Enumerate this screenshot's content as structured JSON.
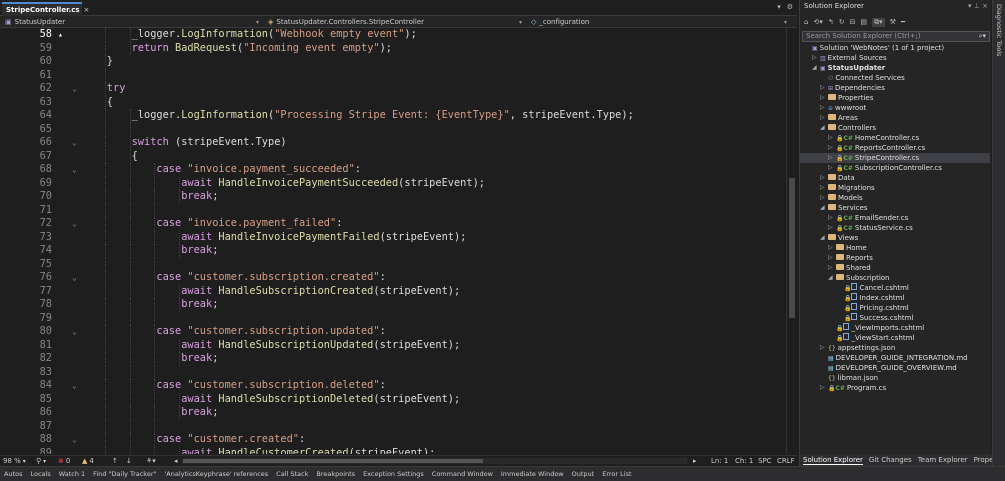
{
  "editor": {
    "tab": {
      "title": "StripeController.cs",
      "pin": "⊞",
      "close": "×"
    },
    "nav": {
      "project": "StatusUpdater",
      "class": "StatusUpdater.Controllers.StripeController",
      "member": "_configuration"
    },
    "lines": [
      {
        "n": "58",
        "cur": true,
        "fold": false,
        "indent": 3,
        "toks": [
          {
            "t": "_logger.",
            "c": "def"
          },
          {
            "t": "LogInformation",
            "c": "yel"
          },
          {
            "t": "(",
            "c": "def"
          },
          {
            "t": "\"Webhook empty event\"",
            "c": "str"
          },
          {
            "t": ");",
            "c": "def"
          }
        ]
      },
      {
        "n": "59",
        "fold": false,
        "indent": 3,
        "toks": [
          {
            "t": "return ",
            "c": "ctl"
          },
          {
            "t": "BadRequest",
            "c": "yel"
          },
          {
            "t": "(",
            "c": "def"
          },
          {
            "t": "\"Incoming event empty\"",
            "c": "str"
          },
          {
            "t": ");",
            "c": "def"
          }
        ]
      },
      {
        "n": "60",
        "fold": false,
        "indent": 2,
        "toks": [
          {
            "t": "}",
            "c": "def"
          }
        ]
      },
      {
        "n": "61",
        "fold": false,
        "indent": 2,
        "toks": []
      },
      {
        "n": "62",
        "fold": true,
        "indent": 2,
        "toks": [
          {
            "t": "try",
            "c": "ctl"
          }
        ]
      },
      {
        "n": "63",
        "fold": false,
        "indent": 2,
        "toks": [
          {
            "t": "{",
            "c": "def"
          }
        ]
      },
      {
        "n": "64",
        "fold": false,
        "indent": 3,
        "toks": [
          {
            "t": "_logger.",
            "c": "def"
          },
          {
            "t": "LogInformation",
            "c": "yel"
          },
          {
            "t": "(",
            "c": "def"
          },
          {
            "t": "\"Processing Stripe Event: {EventType}\"",
            "c": "str"
          },
          {
            "t": ", stripeEvent.",
            "c": "def"
          },
          {
            "t": "Type",
            "c": "def"
          },
          {
            "t": ");",
            "c": "def"
          }
        ]
      },
      {
        "n": "65",
        "fold": false,
        "indent": 3,
        "toks": []
      },
      {
        "n": "66",
        "fold": true,
        "indent": 3,
        "toks": [
          {
            "t": "switch ",
            "c": "ctl"
          },
          {
            "t": "(stripeEvent.Type)",
            "c": "def"
          }
        ]
      },
      {
        "n": "67",
        "fold": false,
        "indent": 3,
        "toks": [
          {
            "t": "{",
            "c": "def"
          }
        ]
      },
      {
        "n": "68",
        "fold": true,
        "indent": 4,
        "toks": [
          {
            "t": "case ",
            "c": "ctl"
          },
          {
            "t": "\"invoice.payment_succeeded\"",
            "c": "str"
          },
          {
            "t": ":",
            "c": "def"
          }
        ]
      },
      {
        "n": "69",
        "fold": false,
        "indent": 5,
        "toks": [
          {
            "t": "await ",
            "c": "ctl"
          },
          {
            "t": "HandleInvoicePaymentSucceeded",
            "c": "yel"
          },
          {
            "t": "(stripeEvent);",
            "c": "def"
          }
        ]
      },
      {
        "n": "70",
        "fold": false,
        "indent": 5,
        "toks": [
          {
            "t": "break",
            "c": "ctl"
          },
          {
            "t": ";",
            "c": "def"
          }
        ]
      },
      {
        "n": "71",
        "fold": false,
        "indent": 4,
        "toks": []
      },
      {
        "n": "72",
        "fold": true,
        "indent": 4,
        "toks": [
          {
            "t": "case ",
            "c": "ctl"
          },
          {
            "t": "\"invoice.payment_failed\"",
            "c": "str"
          },
          {
            "t": ":",
            "c": "def"
          }
        ]
      },
      {
        "n": "73",
        "fold": false,
        "indent": 5,
        "toks": [
          {
            "t": "await ",
            "c": "ctl"
          },
          {
            "t": "HandleInvoicePaymentFailed",
            "c": "yel"
          },
          {
            "t": "(stripeEvent);",
            "c": "def"
          }
        ]
      },
      {
        "n": "74",
        "fold": false,
        "indent": 5,
        "toks": [
          {
            "t": "break",
            "c": "ctl"
          },
          {
            "t": ";",
            "c": "def"
          }
        ]
      },
      {
        "n": "75",
        "fold": false,
        "indent": 4,
        "toks": []
      },
      {
        "n": "76",
        "fold": true,
        "indent": 4,
        "toks": [
          {
            "t": "case ",
            "c": "ctl"
          },
          {
            "t": "\"customer.subscription.created\"",
            "c": "str"
          },
          {
            "t": ":",
            "c": "def"
          }
        ]
      },
      {
        "n": "77",
        "fold": false,
        "indent": 5,
        "toks": [
          {
            "t": "await ",
            "c": "ctl"
          },
          {
            "t": "HandleSubscriptionCreated",
            "c": "yel"
          },
          {
            "t": "(stripeEvent);",
            "c": "def"
          }
        ]
      },
      {
        "n": "78",
        "fold": false,
        "indent": 5,
        "toks": [
          {
            "t": "break",
            "c": "ctl"
          },
          {
            "t": ";",
            "c": "def"
          }
        ]
      },
      {
        "n": "79",
        "fold": false,
        "indent": 4,
        "toks": []
      },
      {
        "n": "80",
        "fold": true,
        "indent": 4,
        "toks": [
          {
            "t": "case ",
            "c": "ctl"
          },
          {
            "t": "\"customer.subscription.updated\"",
            "c": "str"
          },
          {
            "t": ":",
            "c": "def"
          }
        ]
      },
      {
        "n": "81",
        "fold": false,
        "indent": 5,
        "toks": [
          {
            "t": "await ",
            "c": "ctl"
          },
          {
            "t": "HandleSubscriptionUpdated",
            "c": "yel"
          },
          {
            "t": "(stripeEvent);",
            "c": "def"
          }
        ]
      },
      {
        "n": "82",
        "fold": false,
        "indent": 5,
        "toks": [
          {
            "t": "break",
            "c": "ctl"
          },
          {
            "t": ";",
            "c": "def"
          }
        ]
      },
      {
        "n": "83",
        "fold": false,
        "indent": 4,
        "toks": []
      },
      {
        "n": "84",
        "fold": true,
        "indent": 4,
        "toks": [
          {
            "t": "case ",
            "c": "ctl"
          },
          {
            "t": "\"customer.subscription.deleted\"",
            "c": "str"
          },
          {
            "t": ":",
            "c": "def"
          }
        ]
      },
      {
        "n": "85",
        "fold": false,
        "indent": 5,
        "toks": [
          {
            "t": "await ",
            "c": "ctl"
          },
          {
            "t": "HandleSubscriptionDeleted",
            "c": "yel"
          },
          {
            "t": "(stripeEvent);",
            "c": "def"
          }
        ]
      },
      {
        "n": "86",
        "fold": false,
        "indent": 5,
        "toks": [
          {
            "t": "break",
            "c": "ctl"
          },
          {
            "t": ";",
            "c": "def"
          }
        ]
      },
      {
        "n": "87",
        "fold": false,
        "indent": 4,
        "toks": []
      },
      {
        "n": "88",
        "fold": true,
        "indent": 4,
        "toks": [
          {
            "t": "case ",
            "c": "ctl"
          },
          {
            "t": "\"customer.created\"",
            "c": "str"
          },
          {
            "t": ":",
            "c": "def"
          }
        ]
      },
      {
        "n": "89",
        "fold": false,
        "indent": 5,
        "toks": [
          {
            "t": "await ",
            "c": "ctl"
          },
          {
            "t": "HandleCustomerCreated",
            "c": "yel"
          },
          {
            "t": "(stripeEvent);",
            "c": "def"
          }
        ]
      }
    ],
    "status": {
      "zoom": "98 %",
      "errors": "0",
      "warnings": "4",
      "ln": "Ln: 1",
      "ch": "Ch: 1",
      "spc": "SPC",
      "crlf": "CRLF"
    }
  },
  "solution_explorer": {
    "title": "Solution Explorer",
    "search_placeholder": "Search Solution Explorer (Ctrl+;)",
    "items": [
      {
        "label": "Solution 'WebNotes' (1 of 1 project)",
        "depth": 0,
        "icon": "solution",
        "arrow": ""
      },
      {
        "label": "External Sources",
        "depth": 1,
        "icon": "ext",
        "arrow": "▷"
      },
      {
        "label": "StatusUpdater",
        "depth": 1,
        "icon": "project",
        "arrow": "◢",
        "bold": true
      },
      {
        "label": "Connected Services",
        "depth": 2,
        "icon": "services",
        "arrow": ""
      },
      {
        "label": "Dependencies",
        "depth": 2,
        "icon": "deps",
        "arrow": "▷"
      },
      {
        "label": "Properties",
        "depth": 2,
        "icon": "folder",
        "arrow": "▷"
      },
      {
        "label": "wwwroot",
        "depth": 2,
        "icon": "web",
        "arrow": "▷"
      },
      {
        "label": "Areas",
        "depth": 2,
        "icon": "folder",
        "arrow": "▷"
      },
      {
        "label": "Controllers",
        "depth": 2,
        "icon": "folder",
        "arrow": "◢"
      },
      {
        "label": "HomeController.cs",
        "depth": 3,
        "icon": "cs",
        "arrow": "▷"
      },
      {
        "label": "ReportsController.cs",
        "depth": 3,
        "icon": "cs",
        "arrow": "▷"
      },
      {
        "label": "StripeController.cs",
        "depth": 3,
        "icon": "cs",
        "arrow": "▷",
        "selected": true
      },
      {
        "label": "SubscriptionController.cs",
        "depth": 3,
        "icon": "cs",
        "arrow": "▷"
      },
      {
        "label": "Data",
        "depth": 2,
        "icon": "folder",
        "arrow": "▷"
      },
      {
        "label": "Migrations",
        "depth": 2,
        "icon": "folder",
        "arrow": "▷"
      },
      {
        "label": "Models",
        "depth": 2,
        "icon": "folder",
        "arrow": "▷"
      },
      {
        "label": "Services",
        "depth": 2,
        "icon": "folder",
        "arrow": "◢"
      },
      {
        "label": "EmailSender.cs",
        "depth": 3,
        "icon": "cs",
        "arrow": "▷"
      },
      {
        "label": "StatusService.cs",
        "depth": 3,
        "icon": "cs",
        "arrow": "▷"
      },
      {
        "label": "Views",
        "depth": 2,
        "icon": "folder",
        "arrow": "◢"
      },
      {
        "label": "Home",
        "depth": 3,
        "icon": "folder",
        "arrow": "▷"
      },
      {
        "label": "Reports",
        "depth": 3,
        "icon": "folder",
        "arrow": "▷"
      },
      {
        "label": "Shared",
        "depth": 3,
        "icon": "folder",
        "arrow": "▷"
      },
      {
        "label": "Subscription",
        "depth": 3,
        "icon": "folder",
        "arrow": "◢"
      },
      {
        "label": "Cancel.cshtml",
        "depth": 4,
        "icon": "cshtml",
        "arrow": ""
      },
      {
        "label": "Index.cshtml",
        "depth": 4,
        "icon": "cshtml",
        "arrow": ""
      },
      {
        "label": "Pricing.cshtml",
        "depth": 4,
        "icon": "cshtml",
        "arrow": ""
      },
      {
        "label": "Success.cshtml",
        "depth": 4,
        "icon": "cshtml",
        "arrow": ""
      },
      {
        "label": "_ViewImports.cshtml",
        "depth": 3,
        "icon": "cshtml",
        "arrow": ""
      },
      {
        "label": "_ViewStart.cshtml",
        "depth": 3,
        "icon": "cshtml",
        "arrow": ""
      },
      {
        "label": "appsettings.json",
        "depth": 2,
        "icon": "json",
        "arrow": "▷"
      },
      {
        "label": "DEVELOPER_GUIDE_INTEGRATION.md",
        "depth": 2,
        "icon": "md",
        "arrow": ""
      },
      {
        "label": "DEVELOPER_GUIDE_OVERVIEW.md",
        "depth": 2,
        "icon": "md",
        "arrow": ""
      },
      {
        "label": "libman.json",
        "depth": 2,
        "icon": "json",
        "arrow": ""
      },
      {
        "label": "Program.cs",
        "depth": 2,
        "icon": "cs",
        "arrow": "▷"
      }
    ],
    "tabs": [
      "Solution Explorer",
      "Git Changes",
      "Team Explorer",
      "Properties"
    ]
  },
  "side_tab": "Diagnostic Tools",
  "bottom_tabs": [
    "Autos",
    "Locals",
    "Watch 1",
    "Find \"Daily Tracker\"",
    "'AnalyticsKeyphrase' references",
    "Call Stack",
    "Breakpoints",
    "Exception Settings",
    "Command Window",
    "Immediate Window",
    "Output",
    "Error List"
  ]
}
